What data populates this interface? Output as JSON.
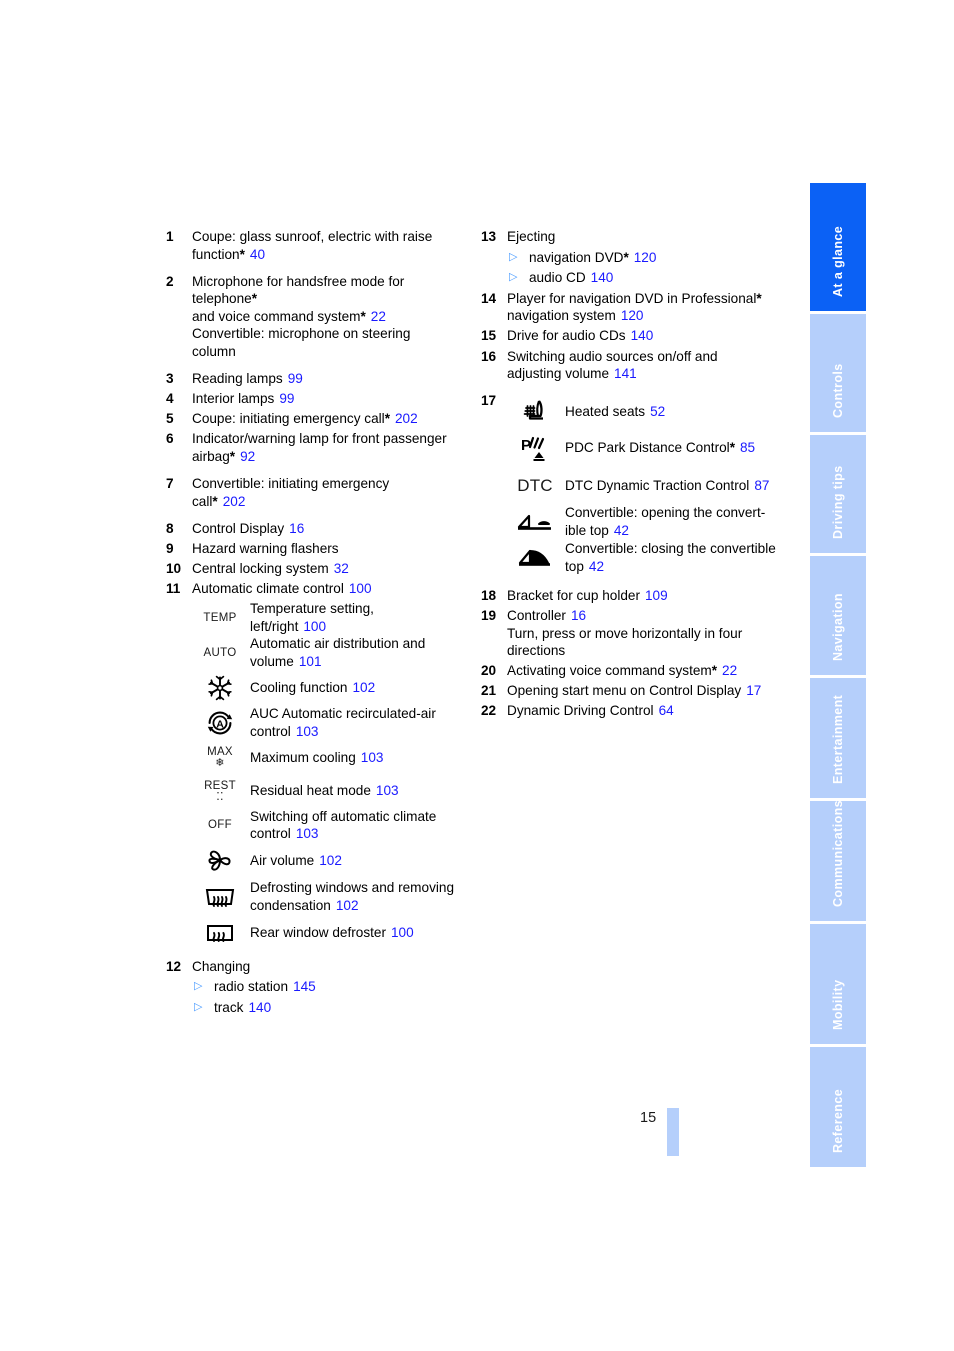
{
  "page": {
    "number": "15"
  },
  "tabs": [
    {
      "label": "At a glance",
      "active": true
    },
    {
      "label": "Controls",
      "active": false
    },
    {
      "label": "Driving tips",
      "active": false
    },
    {
      "label": "Navigation",
      "active": false
    },
    {
      "label": "Entertainment",
      "active": false
    },
    {
      "label": "Communications",
      "active": false
    },
    {
      "label": "Mobility",
      "active": false
    },
    {
      "label": "Reference",
      "active": false
    }
  ],
  "colors": {
    "active_tab": "#0b61f5",
    "inactive_tab": "#b5cffb",
    "page_reference": "#1a1aff",
    "bullet": "#4d9dff"
  },
  "left_column": {
    "item1": {
      "num": "1",
      "line1": "Coupe: glass sunroof, electric with raise",
      "line2": "function",
      "page": "40"
    },
    "item2": {
      "num": "2",
      "line1": "Microphone for handsfree mode for",
      "line2": "telephone",
      "line3": "and voice command system",
      "page": "22",
      "line4": "Convertible: microphone on steering",
      "line5": "column"
    },
    "item3": {
      "num": "3",
      "text": "Reading lamps",
      "page": "99"
    },
    "item4": {
      "num": "4",
      "text": "Interior lamps",
      "page": "99"
    },
    "item5": {
      "num": "5",
      "text": "Coupe: initiating emergency call",
      "page": "202"
    },
    "item6": {
      "num": "6",
      "line1": "Indicator/warning lamp for front passenger",
      "line2": "airbag",
      "page": "92"
    },
    "item7": {
      "num": "7",
      "line1": "Convertible: initiating emergency",
      "line2": "call",
      "page": "202"
    },
    "item8": {
      "num": "8",
      "text": "Control Display",
      "page": "16"
    },
    "item9": {
      "num": "9",
      "text": "Hazard warning flashers",
      "page": ""
    },
    "item10": {
      "num": "10",
      "text": "Central locking system",
      "page": "32"
    },
    "item11": {
      "num": "11",
      "text": "Automatic climate control",
      "page": "100",
      "icons": [
        {
          "icon": "temp-text-icon",
          "icon_text": "TEMP",
          "line1": "Temperature setting,",
          "line2": "left/right",
          "page": "100"
        },
        {
          "icon": "auto-text-icon",
          "icon_text": "AUTO",
          "line1": "Automatic air distribution and",
          "line2": "volume",
          "page": "101"
        },
        {
          "icon": "snowflake-icon",
          "icon_text": "",
          "line1": "Cooling function",
          "line2": "",
          "page": "102"
        },
        {
          "icon": "auc-recirculation-icon",
          "icon_text": "",
          "line1": "AUC Automatic recirculated-air",
          "line2": "control",
          "page": "103"
        },
        {
          "icon": "max-cooling-icon",
          "icon_text": "MAX",
          "line1": "Maximum cooling",
          "line2": "",
          "page": "103"
        },
        {
          "icon": "rest-heat-icon",
          "icon_text": "REST",
          "line1": "Residual heat mode",
          "line2": "",
          "page": "103"
        },
        {
          "icon": "off-text-icon",
          "icon_text": "OFF",
          "line1": "Switching off automatic climate",
          "line2": "control",
          "page": "103"
        },
        {
          "icon": "fan-icon",
          "icon_text": "",
          "line1": "Air volume",
          "line2": "",
          "page": "102"
        },
        {
          "icon": "windshield-defrost-icon",
          "icon_text": "",
          "line1": "Defrosting windows and removing",
          "line2": "condensation",
          "page": "102"
        },
        {
          "icon": "rear-window-defrost-icon",
          "icon_text": "",
          "line1": "Rear window defroster",
          "line2": "",
          "page": "100"
        }
      ]
    },
    "item12": {
      "num": "12",
      "text": "Changing",
      "subitems": [
        {
          "text": "radio station",
          "page": "145"
        },
        {
          "text": "track",
          "page": "140"
        }
      ]
    }
  },
  "right_column": {
    "item13": {
      "num": "13",
      "text": "Ejecting",
      "subitems": [
        {
          "text": "navigation DVD",
          "starred": true,
          "page": "120"
        },
        {
          "text": "audio CD",
          "starred": false,
          "page": "140"
        }
      ]
    },
    "item14": {
      "num": "14",
      "line1": "Player for navigation DVD in Professional",
      "line2": "navigation system",
      "page": "120"
    },
    "item15": {
      "num": "15",
      "text": "Drive for audio CDs",
      "page": "140"
    },
    "item16": {
      "num": "16",
      "line1": "Switching audio sources on/off and",
      "line2": "adjusting volume",
      "page": "141"
    },
    "item17": {
      "num": "17",
      "icons": [
        {
          "icon": "heated-seat-icon",
          "line1": "Heated seats",
          "line2": "",
          "page": "52",
          "starred": false
        },
        {
          "icon": "pdc-icon",
          "line1": "PDC Park Distance Control",
          "line2": "",
          "page": "85",
          "starred": true
        },
        {
          "icon": "dtc-text-icon",
          "icon_text": "DTC",
          "line1": "DTC Dynamic Traction Control",
          "line2": "",
          "page": "87",
          "starred": false
        },
        {
          "icon": "convertible-top-open-icon",
          "line1": "Convertible: opening the convert-",
          "line2": "ible top",
          "page": "42",
          "starred": false
        },
        {
          "icon": "convertible-top-close-icon",
          "line1": "Convertible: closing the convertible",
          "line2": "top",
          "page": "42",
          "starred": false
        }
      ]
    },
    "item18": {
      "num": "18",
      "text": "Bracket for cup holder",
      "page": "109"
    },
    "item19": {
      "num": "19",
      "line1": "Controller",
      "page": "16",
      "line2": "Turn, press or move horizontally in four",
      "line3": "directions"
    },
    "item20": {
      "num": "20",
      "text": "Activating voice command system",
      "page": "22"
    },
    "item21": {
      "num": "21",
      "text": "Opening start menu on Control Display",
      "page": "17"
    },
    "item22": {
      "num": "22",
      "text": "Dynamic Driving Control",
      "page": "64"
    }
  }
}
